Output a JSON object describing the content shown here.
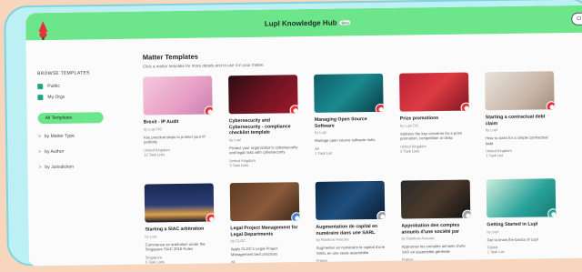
{
  "app": {
    "title": "Lupl Knowledge Hub",
    "beta": "Beta",
    "close_label": "Cl"
  },
  "sidebar": {
    "heading": "BROWSE TEMPLATES",
    "checks": [
      "Public",
      "My Orgs"
    ],
    "active_item": "All Templates",
    "filters": [
      "by Matter Type",
      "by Author",
      "by Jurisdiction"
    ]
  },
  "main": {
    "title": "Matter Templates",
    "subtitle": "Click a matter template for more details and to use it in your matter."
  },
  "colors": {
    "accent": "#6de58a",
    "badge_red": "#e5333b",
    "badge_blue": "#3a7fe0",
    "badge_gray": "#9aa0a6",
    "badge_teal": "#2aa39a"
  },
  "cards": [
    {
      "title": "Brexit - IP Audit",
      "author": "by Lupl OG",
      "desc": "Key practical steps to protect your IP portfolio",
      "meta1": "United Kingdom",
      "meta2": "12 Task Lists",
      "badge": "red",
      "thumb": "bulb"
    },
    {
      "title": "Cybersecurity and Cybersecurity - compliance checklist template",
      "author": "by Lupl",
      "desc": "Protect your organization's cybersecurity and legal risks with cybersecurity",
      "meta1": "United Kingdom",
      "meta2": "3 Task Lists",
      "badge": "red",
      "thumb": "cyber"
    },
    {
      "title": "Managing Open Source Software",
      "author": "by Lupl",
      "desc": "Manage open source software risks.",
      "meta1": "All",
      "meta2": "1 Task List",
      "badge": "red",
      "thumb": "code"
    },
    {
      "title": "Prize promotions",
      "author": "by Lupl OG",
      "desc": "Address the key concerns for a prize promotion, competition or draw.",
      "meta1": "United Kingdom",
      "meta2": "2 Task Lists",
      "badge": "red",
      "thumb": "tickets"
    },
    {
      "title": "Starting a contractual debt claim",
      "author": "by Lupl",
      "desc": "How to claim for a simple contractual debt",
      "meta1": "United Kingdom",
      "meta2": "1 Task List",
      "badge": "red",
      "thumb": "paper"
    },
    {
      "title": "Starting a SIAC arbitration",
      "author": "by Lupl",
      "desc": "Commence an arbitration under the Singapore SIAC 2016 Rules",
      "meta1": "Singapore",
      "meta2": "5 Task Lists",
      "badge": "red",
      "thumb": "city"
    },
    {
      "title": "Legal Project Management for Legal Departments",
      "author": "by CLOC",
      "desc": "Apply CLOC's Legal Project Management best practices",
      "meta1": "All",
      "meta2": "6 Task Lists",
      "badge": "blue",
      "thumb": "desk"
    },
    {
      "title": "Augmentation de capital en numéraire dans une SARL",
      "author": "by Rainbow Avocats",
      "desc": "Augmenter en numéraire le capital d'une SARL en une seule assemblée",
      "meta1": "France",
      "meta2": "4 Task Lists",
      "badge": "gray",
      "thumb": "laptop"
    },
    {
      "title": "Approbation des comptes annuels d'une société par",
      "author": "by Rainbow Avocats",
      "desc": "Approuver les comptes annuels d'une SAS en assemblée générale",
      "meta1": "France",
      "meta2": "3 Task Lists",
      "badge": "gray",
      "thumb": "tablet"
    },
    {
      "title": "Getting Started in Lupl",
      "author": "by Lupl",
      "desc": "Get to know the basics of Lupl",
      "meta1": "Global",
      "meta2": "1 Task List",
      "badge": "teal",
      "thumb": "green"
    }
  ]
}
